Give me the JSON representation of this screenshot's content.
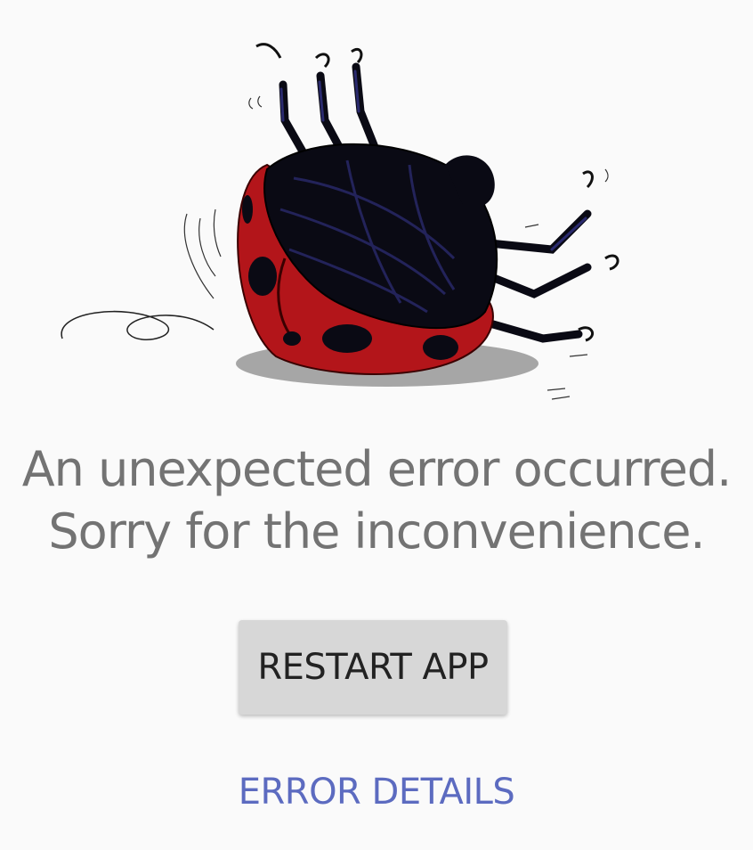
{
  "error_screen": {
    "illustration_icon": "overturned-ladybug-icon",
    "message_line1": "An unexpected error occurred.",
    "message_line2": "Sorry for the inconvenience.",
    "restart_label": "RESTART APP",
    "details_label": "ERROR DETAILS"
  },
  "colors": {
    "background": "#fafafa",
    "message_text": "#737373",
    "button_bg": "#d7d7d7",
    "button_text": "#222222",
    "link_text": "#5c6bc0",
    "ladybug_red": "#b3151a",
    "ladybug_black": "#0a0a14"
  }
}
